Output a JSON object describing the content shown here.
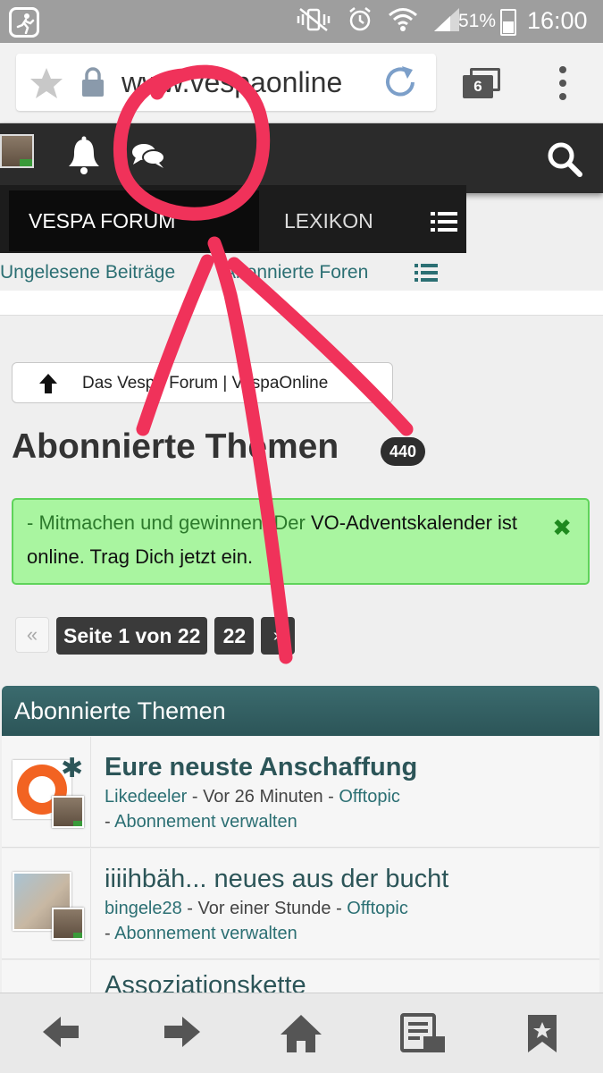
{
  "status_bar": {
    "battery": "51%",
    "time": "16:00"
  },
  "browser": {
    "url": "www.vespaonline",
    "tab_count": "6"
  },
  "nav_menu": {
    "forum_label": "VESPA FORUM",
    "forum_badge": "",
    "lexikon_label": "LEXIKON"
  },
  "sub_nav": {
    "unread": "Ungelesene Beiträge",
    "subscribed": "Abonnierte Foren"
  },
  "breadcrumb": {
    "label": "Das Vespa Forum | VespaOnline"
  },
  "page": {
    "title": "Abonnierte Themen",
    "count": "440"
  },
  "notice": {
    "prefix": "- Mitmachen und gewinnen! Der ",
    "highlight": "VO-Adventskalender ist online. Trag Dich jetzt ein."
  },
  "pagination": {
    "prev": "«",
    "info": "Seite 1 von 22",
    "last": "22",
    "next": "»"
  },
  "topic_list": {
    "header": "Abonnierte Themen",
    "topics": [
      {
        "title": "Eure neuste Anschaffung",
        "author": "Likedeeler",
        "time": " - Vor 26 Minuten - ",
        "forum": "Offtopic",
        "manage_dash": "- ",
        "manage": "Abonnement verwalten"
      },
      {
        "title": "iiiihbäh... neues aus der bucht",
        "author": "bingele28",
        "time": " - Vor einer Stunde - ",
        "forum": "Offtopic",
        "manage_dash": "- ",
        "manage": "Abonnement verwalten"
      },
      {
        "title": "Assoziationskette"
      }
    ]
  },
  "colors": {
    "accent": "#2c5558",
    "notice_bg": "#a9f5a0",
    "annotation": "#f0325a"
  }
}
